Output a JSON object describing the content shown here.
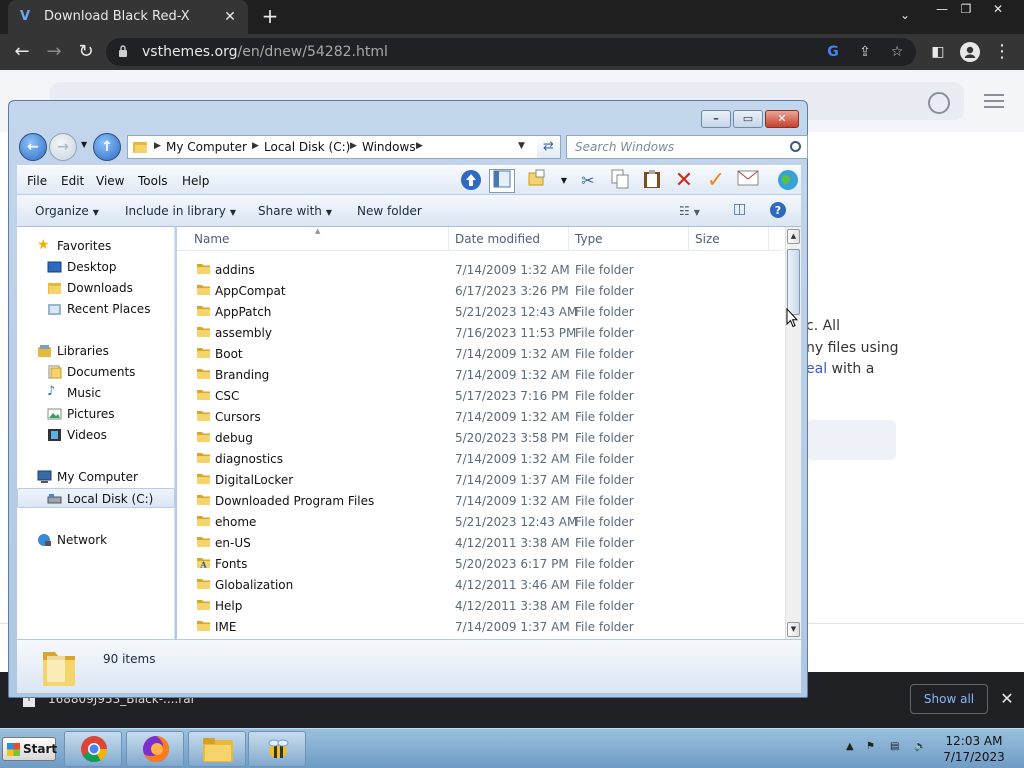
{
  "browser": {
    "tab_title": "Download Black Red-X",
    "tab_favicon": "V",
    "url_domain": "vsthemes.org",
    "url_path": "/en/dnew/54282.html"
  },
  "webpage": {
    "text_lines": [
      "c. All",
      "ny files using"
    ],
    "link_text": "eal",
    "link_tail": "with a"
  },
  "download_bar": {
    "filename": "168809J953_Black-....rar",
    "show_all": "Show all"
  },
  "explorer": {
    "address": [
      "My Computer",
      "Local Disk (C:)",
      "Windows"
    ],
    "search_placeholder": "Search Windows",
    "menu": [
      "File",
      "Edit",
      "View",
      "Tools",
      "Help"
    ],
    "commands": {
      "organize": "Organize",
      "include": "Include in library",
      "share": "Share with",
      "new_folder": "New folder"
    },
    "nav": {
      "favorites": "Favorites",
      "desktop": "Desktop",
      "downloads": "Downloads",
      "recent": "Recent Places",
      "libraries": "Libraries",
      "documents": "Documents",
      "music": "Music",
      "pictures": "Pictures",
      "videos": "Videos",
      "computer": "My Computer",
      "localdisk": "Local Disk (C:)",
      "network": "Network"
    },
    "columns": {
      "name": "Name",
      "date": "Date modified",
      "type": "Type",
      "size": "Size"
    },
    "files": [
      {
        "name": "addins",
        "date": "7/14/2009 1:32 AM",
        "type": "File folder"
      },
      {
        "name": "AppCompat",
        "date": "6/17/2023 3:26 PM",
        "type": "File folder"
      },
      {
        "name": "AppPatch",
        "date": "5/21/2023 12:43 AM",
        "type": "File folder"
      },
      {
        "name": "assembly",
        "date": "7/16/2023 11:53 PM",
        "type": "File folder"
      },
      {
        "name": "Boot",
        "date": "7/14/2009 1:32 AM",
        "type": "File folder"
      },
      {
        "name": "Branding",
        "date": "7/14/2009 1:32 AM",
        "type": "File folder"
      },
      {
        "name": "CSC",
        "date": "5/17/2023 7:16 PM",
        "type": "File folder"
      },
      {
        "name": "Cursors",
        "date": "7/14/2009 1:32 AM",
        "type": "File folder"
      },
      {
        "name": "debug",
        "date": "5/20/2023 3:58 PM",
        "type": "File folder"
      },
      {
        "name": "diagnostics",
        "date": "7/14/2009 1:32 AM",
        "type": "File folder"
      },
      {
        "name": "DigitalLocker",
        "date": "7/14/2009 1:37 AM",
        "type": "File folder"
      },
      {
        "name": "Downloaded Program Files",
        "date": "7/14/2009 1:32 AM",
        "type": "File folder"
      },
      {
        "name": "ehome",
        "date": "5/21/2023 12:43 AM",
        "type": "File folder"
      },
      {
        "name": "en-US",
        "date": "4/12/2011 3:38 AM",
        "type": "File folder"
      },
      {
        "name": "Fonts",
        "date": "5/20/2023 6:17 PM",
        "type": "File folder"
      },
      {
        "name": "Globalization",
        "date": "4/12/2011 3:46 AM",
        "type": "File folder"
      },
      {
        "name": "Help",
        "date": "4/12/2011 3:38 AM",
        "type": "File folder"
      },
      {
        "name": "IME",
        "date": "7/14/2009 1:37 AM",
        "type": "File folder"
      }
    ],
    "item_count": "90 items"
  },
  "taskbar": {
    "start": "Start",
    "time": "12:03 AM",
    "date": "7/17/2023"
  },
  "colors": {
    "folder": "#f2c94c",
    "explorer_frame": "#c3d6ec",
    "chrome_dark": "#353535",
    "link": "#3b5bc0"
  }
}
